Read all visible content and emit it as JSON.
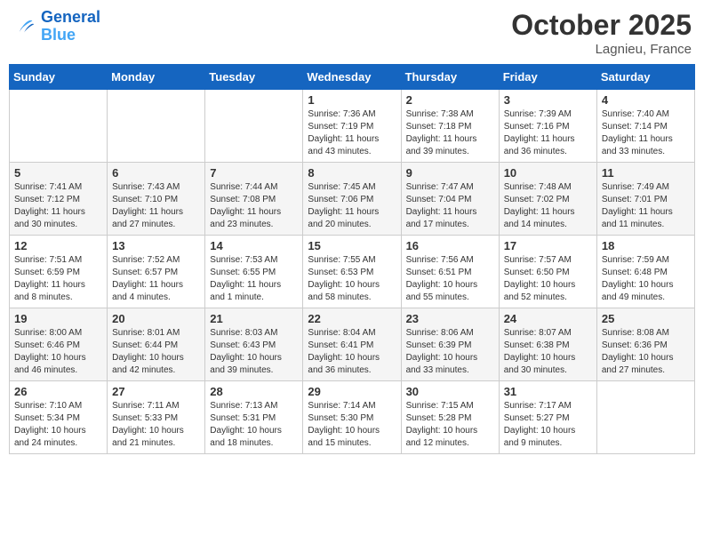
{
  "header": {
    "logo_line1": "General",
    "logo_line2": "Blue",
    "month": "October 2025",
    "location": "Lagnieu, France"
  },
  "weekdays": [
    "Sunday",
    "Monday",
    "Tuesday",
    "Wednesday",
    "Thursday",
    "Friday",
    "Saturday"
  ],
  "weeks": [
    [
      {
        "day": "",
        "sunrise": "",
        "sunset": "",
        "daylight": ""
      },
      {
        "day": "",
        "sunrise": "",
        "sunset": "",
        "daylight": ""
      },
      {
        "day": "",
        "sunrise": "",
        "sunset": "",
        "daylight": ""
      },
      {
        "day": "1",
        "sunrise": "Sunrise: 7:36 AM",
        "sunset": "Sunset: 7:19 PM",
        "daylight": "Daylight: 11 hours and 43 minutes."
      },
      {
        "day": "2",
        "sunrise": "Sunrise: 7:38 AM",
        "sunset": "Sunset: 7:18 PM",
        "daylight": "Daylight: 11 hours and 39 minutes."
      },
      {
        "day": "3",
        "sunrise": "Sunrise: 7:39 AM",
        "sunset": "Sunset: 7:16 PM",
        "daylight": "Daylight: 11 hours and 36 minutes."
      },
      {
        "day": "4",
        "sunrise": "Sunrise: 7:40 AM",
        "sunset": "Sunset: 7:14 PM",
        "daylight": "Daylight: 11 hours and 33 minutes."
      }
    ],
    [
      {
        "day": "5",
        "sunrise": "Sunrise: 7:41 AM",
        "sunset": "Sunset: 7:12 PM",
        "daylight": "Daylight: 11 hours and 30 minutes."
      },
      {
        "day": "6",
        "sunrise": "Sunrise: 7:43 AM",
        "sunset": "Sunset: 7:10 PM",
        "daylight": "Daylight: 11 hours and 27 minutes."
      },
      {
        "day": "7",
        "sunrise": "Sunrise: 7:44 AM",
        "sunset": "Sunset: 7:08 PM",
        "daylight": "Daylight: 11 hours and 23 minutes."
      },
      {
        "day": "8",
        "sunrise": "Sunrise: 7:45 AM",
        "sunset": "Sunset: 7:06 PM",
        "daylight": "Daylight: 11 hours and 20 minutes."
      },
      {
        "day": "9",
        "sunrise": "Sunrise: 7:47 AM",
        "sunset": "Sunset: 7:04 PM",
        "daylight": "Daylight: 11 hours and 17 minutes."
      },
      {
        "day": "10",
        "sunrise": "Sunrise: 7:48 AM",
        "sunset": "Sunset: 7:02 PM",
        "daylight": "Daylight: 11 hours and 14 minutes."
      },
      {
        "day": "11",
        "sunrise": "Sunrise: 7:49 AM",
        "sunset": "Sunset: 7:01 PM",
        "daylight": "Daylight: 11 hours and 11 minutes."
      }
    ],
    [
      {
        "day": "12",
        "sunrise": "Sunrise: 7:51 AM",
        "sunset": "Sunset: 6:59 PM",
        "daylight": "Daylight: 11 hours and 8 minutes."
      },
      {
        "day": "13",
        "sunrise": "Sunrise: 7:52 AM",
        "sunset": "Sunset: 6:57 PM",
        "daylight": "Daylight: 11 hours and 4 minutes."
      },
      {
        "day": "14",
        "sunrise": "Sunrise: 7:53 AM",
        "sunset": "Sunset: 6:55 PM",
        "daylight": "Daylight: 11 hours and 1 minute."
      },
      {
        "day": "15",
        "sunrise": "Sunrise: 7:55 AM",
        "sunset": "Sunset: 6:53 PM",
        "daylight": "Daylight: 10 hours and 58 minutes."
      },
      {
        "day": "16",
        "sunrise": "Sunrise: 7:56 AM",
        "sunset": "Sunset: 6:51 PM",
        "daylight": "Daylight: 10 hours and 55 minutes."
      },
      {
        "day": "17",
        "sunrise": "Sunrise: 7:57 AM",
        "sunset": "Sunset: 6:50 PM",
        "daylight": "Daylight: 10 hours and 52 minutes."
      },
      {
        "day": "18",
        "sunrise": "Sunrise: 7:59 AM",
        "sunset": "Sunset: 6:48 PM",
        "daylight": "Daylight: 10 hours and 49 minutes."
      }
    ],
    [
      {
        "day": "19",
        "sunrise": "Sunrise: 8:00 AM",
        "sunset": "Sunset: 6:46 PM",
        "daylight": "Daylight: 10 hours and 46 minutes."
      },
      {
        "day": "20",
        "sunrise": "Sunrise: 8:01 AM",
        "sunset": "Sunset: 6:44 PM",
        "daylight": "Daylight: 10 hours and 42 minutes."
      },
      {
        "day": "21",
        "sunrise": "Sunrise: 8:03 AM",
        "sunset": "Sunset: 6:43 PM",
        "daylight": "Daylight: 10 hours and 39 minutes."
      },
      {
        "day": "22",
        "sunrise": "Sunrise: 8:04 AM",
        "sunset": "Sunset: 6:41 PM",
        "daylight": "Daylight: 10 hours and 36 minutes."
      },
      {
        "day": "23",
        "sunrise": "Sunrise: 8:06 AM",
        "sunset": "Sunset: 6:39 PM",
        "daylight": "Daylight: 10 hours and 33 minutes."
      },
      {
        "day": "24",
        "sunrise": "Sunrise: 8:07 AM",
        "sunset": "Sunset: 6:38 PM",
        "daylight": "Daylight: 10 hours and 30 minutes."
      },
      {
        "day": "25",
        "sunrise": "Sunrise: 8:08 AM",
        "sunset": "Sunset: 6:36 PM",
        "daylight": "Daylight: 10 hours and 27 minutes."
      }
    ],
    [
      {
        "day": "26",
        "sunrise": "Sunrise: 7:10 AM",
        "sunset": "Sunset: 5:34 PM",
        "daylight": "Daylight: 10 hours and 24 minutes."
      },
      {
        "day": "27",
        "sunrise": "Sunrise: 7:11 AM",
        "sunset": "Sunset: 5:33 PM",
        "daylight": "Daylight: 10 hours and 21 minutes."
      },
      {
        "day": "28",
        "sunrise": "Sunrise: 7:13 AM",
        "sunset": "Sunset: 5:31 PM",
        "daylight": "Daylight: 10 hours and 18 minutes."
      },
      {
        "day": "29",
        "sunrise": "Sunrise: 7:14 AM",
        "sunset": "Sunset: 5:30 PM",
        "daylight": "Daylight: 10 hours and 15 minutes."
      },
      {
        "day": "30",
        "sunrise": "Sunrise: 7:15 AM",
        "sunset": "Sunset: 5:28 PM",
        "daylight": "Daylight: 10 hours and 12 minutes."
      },
      {
        "day": "31",
        "sunrise": "Sunrise: 7:17 AM",
        "sunset": "Sunset: 5:27 PM",
        "daylight": "Daylight: 10 hours and 9 minutes."
      },
      {
        "day": "",
        "sunrise": "",
        "sunset": "",
        "daylight": ""
      }
    ]
  ]
}
